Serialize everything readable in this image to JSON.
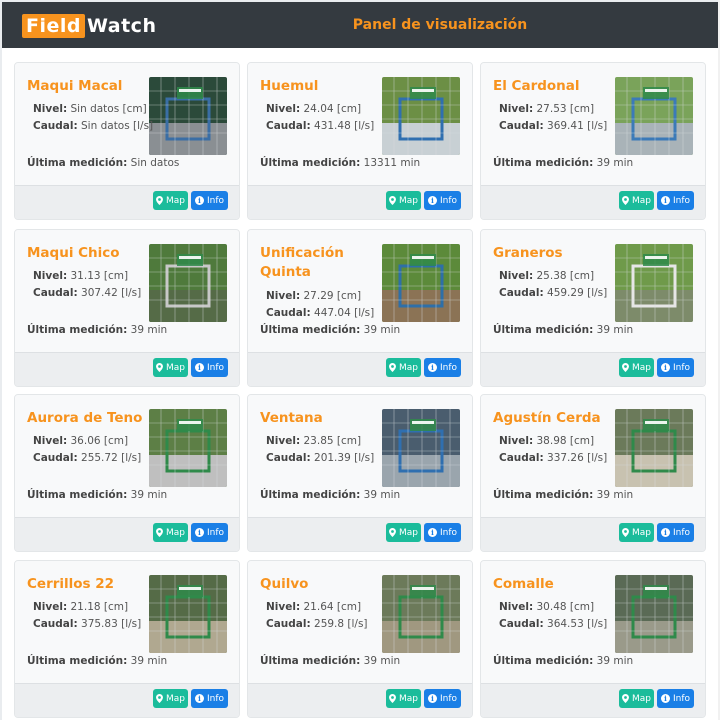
{
  "header": {
    "logo_part1": "Field",
    "logo_part2": "Watch",
    "title": "Panel de visualización"
  },
  "labels": {
    "nivel": "Nivel:",
    "caudal": "Caudal:",
    "ultima": "Última medición:",
    "map": "Map",
    "info": "Info"
  },
  "colors": {
    "accent": "#f7931e",
    "navbar": "#343a40",
    "map_button": "#1bbc9b",
    "info_button": "#1a7fe6"
  },
  "icons": {
    "map": "map-marker-icon",
    "info": "info-circle-icon"
  },
  "stations": [
    {
      "name": "Maqui Macal",
      "nivel": "Sin datos [cm]",
      "caudal": "Sin datos [l/s]",
      "ultima": "Sin datos"
    },
    {
      "name": "Huemul",
      "nivel": "24.04 [cm]",
      "caudal": "431.48 [l/s]",
      "ultima": "13311 min"
    },
    {
      "name": "El Cardonal",
      "nivel": "27.53 [cm]",
      "caudal": "369.41 [l/s]",
      "ultima": "39 min"
    },
    {
      "name": "Maqui Chico",
      "nivel": "31.13 [cm]",
      "caudal": "307.42 [l/s]",
      "ultima": "39 min"
    },
    {
      "name": "Unificación Quinta",
      "nivel": "27.29 [cm]",
      "caudal": "447.04 [l/s]",
      "ultima": "39 min"
    },
    {
      "name": "Graneros",
      "nivel": "25.38 [cm]",
      "caudal": "459.29 [l/s]",
      "ultima": "39 min"
    },
    {
      "name": "Aurora de Teno",
      "nivel": "36.06 [cm]",
      "caudal": "255.72 [l/s]",
      "ultima": "39 min"
    },
    {
      "name": "Ventana",
      "nivel": "23.85 [cm]",
      "caudal": "201.39 [l/s]",
      "ultima": "39 min"
    },
    {
      "name": "Agustín Cerda",
      "nivel": "38.98 [cm]",
      "caudal": "337.26 [l/s]",
      "ultima": "39 min"
    },
    {
      "name": "Cerrillos 22",
      "nivel": "21.18 [cm]",
      "caudal": "375.83 [l/s]",
      "ultima": "39 min"
    },
    {
      "name": "Quilvo",
      "nivel": "21.64 [cm]",
      "caudal": "259.8 [l/s]",
      "ultima": "39 min"
    },
    {
      "name": "Comalle",
      "nivel": "30.48 [cm]",
      "caudal": "364.53 [l/s]",
      "ultima": "39 min"
    }
  ]
}
